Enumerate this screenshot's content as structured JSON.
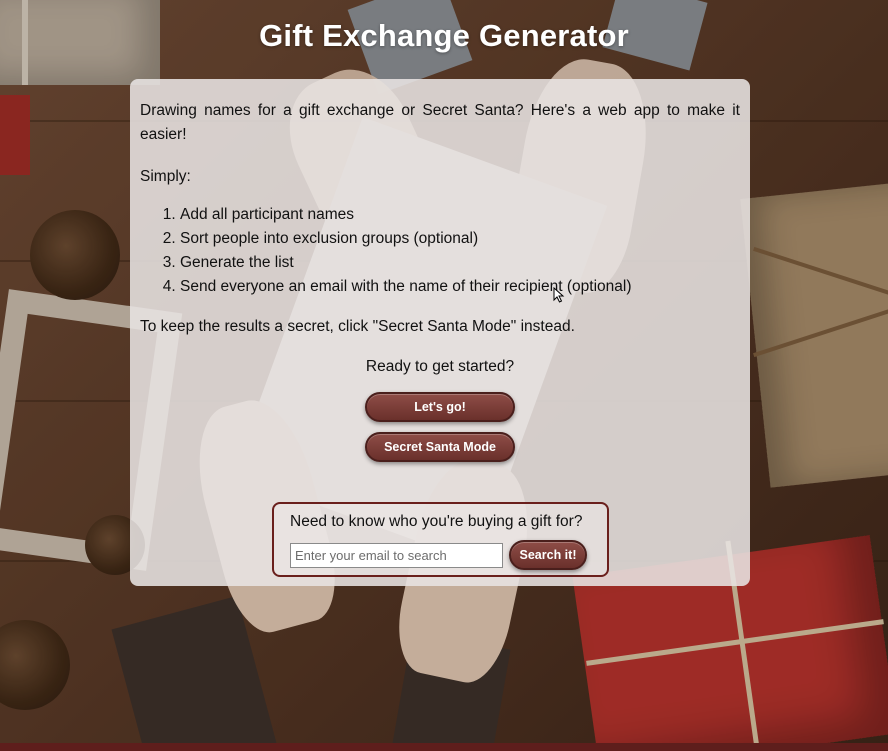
{
  "header": {
    "title": "Gift Exchange Generator"
  },
  "intro": {
    "description": "Drawing names for a gift exchange or Secret Santa? Here's a web app to make it easier!",
    "simply": "Simply:",
    "steps": [
      "Add all participant names",
      "Sort people into exclusion groups (optional)",
      "Generate the list",
      "Send everyone an email with the name of their recipient (optional)"
    ],
    "secret_note": "To keep the results a secret, click \"Secret Santa Mode\" instead.",
    "ready": "Ready to get started?"
  },
  "actions": {
    "lets_go_label": "Let's go!",
    "secret_santa_label": "Secret Santa Mode"
  },
  "search": {
    "label": "Need to know who you're buying a gift for?",
    "placeholder": "Enter your email to search",
    "value": "",
    "button_label": "Search it!"
  },
  "icons": {
    "cursor": "mouse-cursor-icon"
  },
  "colors": {
    "button_bg": "#7a3b36",
    "button_border": "#4a1f1c",
    "search_box_border": "#6a1f1c",
    "panel_bg": "#e8e4e2",
    "title_text": "#ffffff",
    "bottom_bar": "#5e1e1c"
  }
}
